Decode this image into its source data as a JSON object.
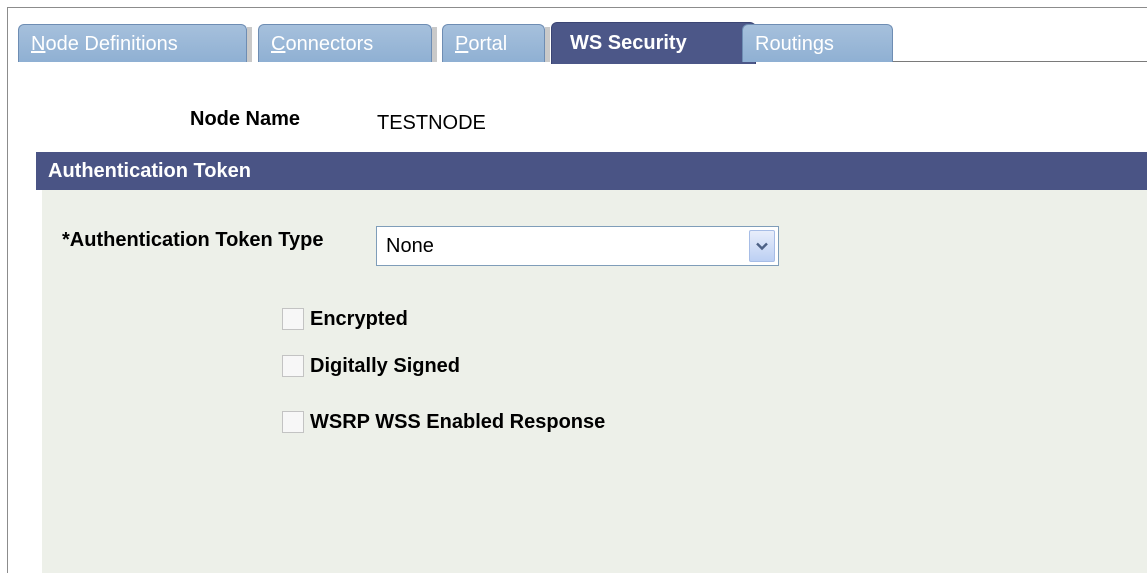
{
  "tabs": [
    {
      "label": "Node Definitions",
      "access_key": "N",
      "rest": "ode Definitions",
      "active": false
    },
    {
      "label": "Connectors",
      "access_key": "C",
      "rest": "onnectors",
      "active": false
    },
    {
      "label": "Portal",
      "access_key": "P",
      "rest": "ortal",
      "active": false
    },
    {
      "label": "WS Security",
      "active": true
    },
    {
      "label": "Routings",
      "active": false
    }
  ],
  "node": {
    "label": "Node Name",
    "value": "TESTNODE"
  },
  "section": {
    "title": "Authentication Token"
  },
  "token_type": {
    "label": "*Authentication Token Type",
    "selected": "None"
  },
  "checkboxes": [
    {
      "label": "Encrypted",
      "checked": false
    },
    {
      "label": "Digitally Signed",
      "checked": false
    },
    {
      "label": "WSRP WSS Enabled Response",
      "checked": false
    }
  ],
  "colors": {
    "tab_inactive": "#97b6d8",
    "tab_active": "#4c5788",
    "section_header": "#4a5485",
    "section_body": "#edf0e9"
  },
  "icons": {
    "dropdown": "chevron-down-icon"
  }
}
